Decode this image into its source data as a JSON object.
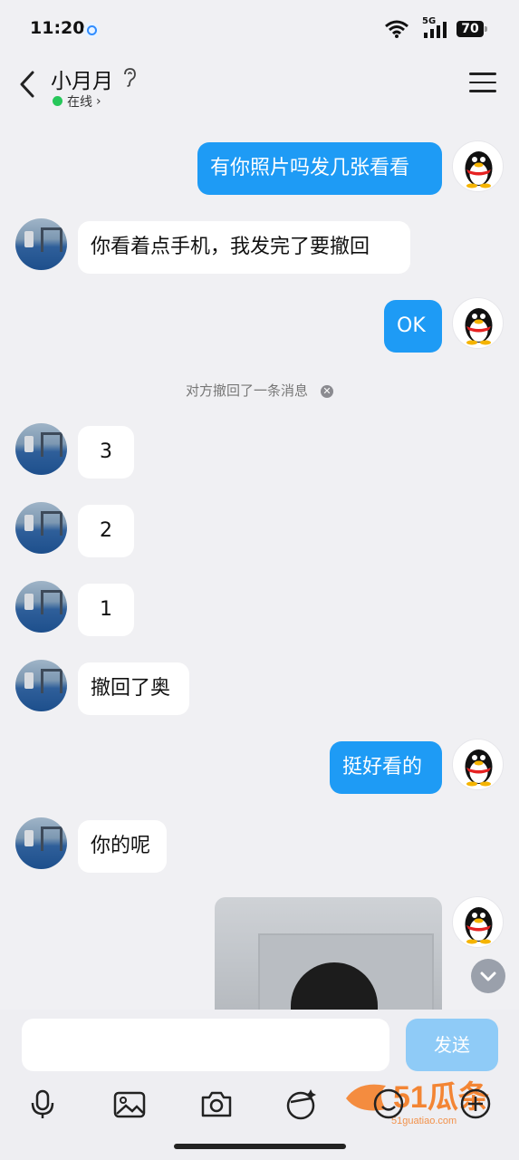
{
  "status_bar": {
    "time": "11:20",
    "network": "5G",
    "battery": "70"
  },
  "header": {
    "title": "小月月",
    "status": "在线"
  },
  "messages": [
    {
      "side": "out",
      "text": "有你照片吗发几张看看"
    },
    {
      "side": "in",
      "text": "你看着点手机，我发完了要撤回"
    },
    {
      "side": "out",
      "text": "OK"
    },
    {
      "side": "in",
      "text": "3"
    },
    {
      "side": "in",
      "text": "2"
    },
    {
      "side": "in",
      "text": "1"
    },
    {
      "side": "in",
      "text": "撤回了奥"
    },
    {
      "side": "out",
      "text": "挺好看的"
    },
    {
      "side": "in",
      "text": "你的呢"
    }
  ],
  "system_notice": "对方撤回了一条消息",
  "input": {
    "placeholder": "",
    "send_label": "发送"
  },
  "toolbar": [
    "mic-icon",
    "image-icon",
    "camera-icon",
    "sticker-icon",
    "emoji-icon",
    "plus-icon"
  ],
  "watermark": {
    "text": "51瓜条",
    "url": "51guatiao.com"
  },
  "colors": {
    "outgoing": "#1e9bf5",
    "incoming": "#ffffff",
    "background": "#f0f0f3",
    "online": "#27c75a"
  }
}
